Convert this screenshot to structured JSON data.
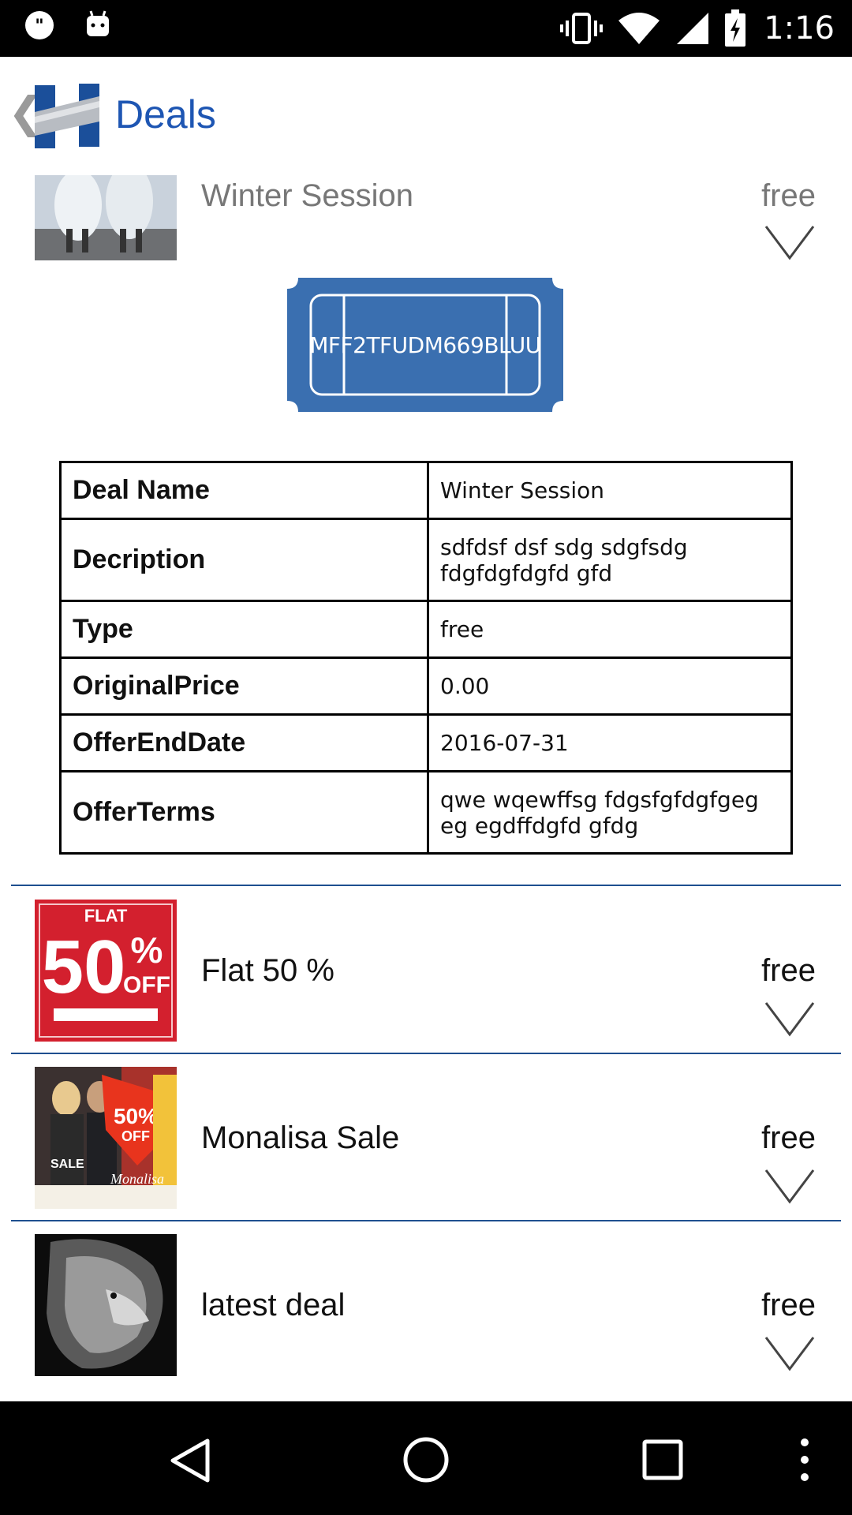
{
  "status_bar": {
    "time": "1:16",
    "icons": [
      "quote-notification-icon",
      "android-notification-icon",
      "vibrate-icon",
      "wifi-icon",
      "signal-icon",
      "battery-charging-icon"
    ]
  },
  "app_bar": {
    "title": "Deals",
    "logo": "h-logo"
  },
  "expanded_deal": {
    "name": "Winter Session",
    "type": "free",
    "coupon_code": "MFF2TFUDM669BLUU",
    "details": [
      {
        "key": "Deal Name",
        "value": "Winter Session"
      },
      {
        "key": "Decription",
        "value": "sdfdsf dsf sdg sdgfsdg fdgfdgfdgfd gfd"
      },
      {
        "key": "Type",
        "value": "free"
      },
      {
        "key": "OriginalPrice",
        "value": "0.00"
      },
      {
        "key": "OfferEndDate",
        "value": "2016-07-31"
      },
      {
        "key": "OfferTerms",
        "value": "qwe wqewffsg fdgsfgfdgfgeg eg egdffdgfd gfdg"
      }
    ]
  },
  "deals": [
    {
      "name": "Flat 50 %",
      "type": "free",
      "thumb": "flat-50-off-thumbnail"
    },
    {
      "name": "Monalisa Sale",
      "type": "free",
      "thumb": "monalisa-sale-thumbnail"
    },
    {
      "name": "latest deal",
      "type": "free",
      "thumb": "lion-thumbnail"
    }
  ],
  "thumb_texts": {
    "flat": "FLAT",
    "fifty": "50",
    "pct": "%",
    "off": "OFF",
    "mona_pct": "50%",
    "mona_off": "OFF",
    "mona_brand": "Monalisa",
    "mona_sale": "SALE"
  },
  "colors": {
    "accent": "#1e56b3",
    "divider": "#1e4f8f",
    "coupon": "#3a6fb0"
  }
}
